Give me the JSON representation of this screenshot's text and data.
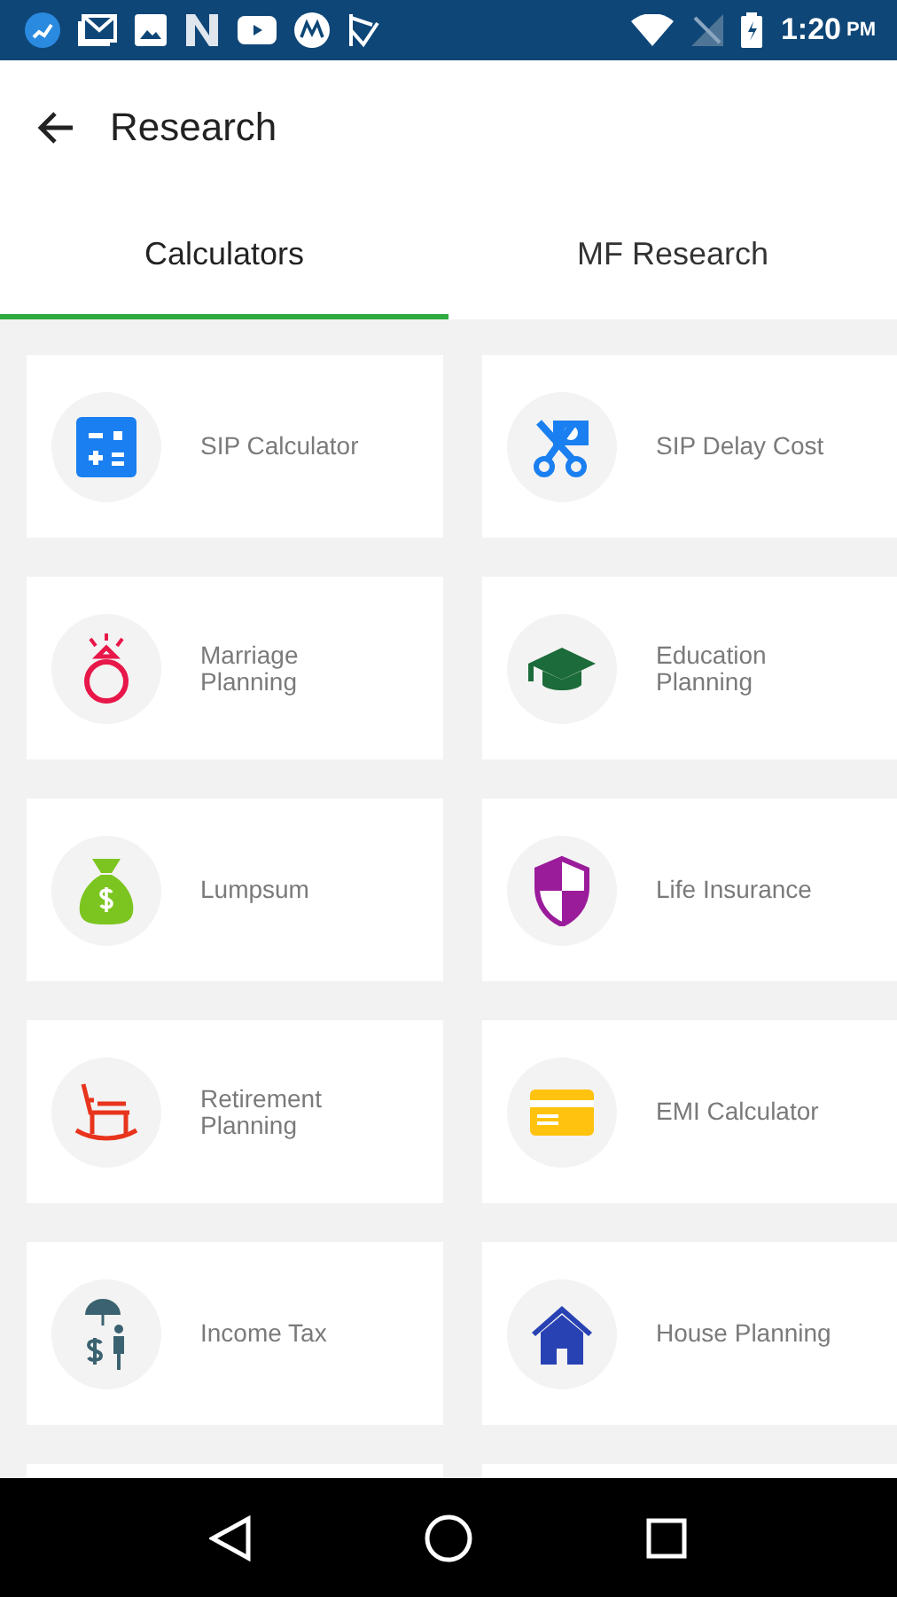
{
  "status_bar": {
    "time": "1:20",
    "period": "PM"
  },
  "app_bar": {
    "title": "Research"
  },
  "tabs": [
    {
      "label": "Calculators",
      "selected": true
    },
    {
      "label": "MF Research",
      "selected": false
    }
  ],
  "tools": [
    {
      "label": "SIP Calculator",
      "kind": "calculator"
    },
    {
      "label": "SIP Delay Cost",
      "kind": "scissors"
    },
    {
      "label": "Marriage\nPlanning",
      "kind": "ring"
    },
    {
      "label": "Education\nPlanning",
      "kind": "cap"
    },
    {
      "label": "Lumpsum",
      "kind": "moneybag"
    },
    {
      "label": "Life Insurance",
      "kind": "shield"
    },
    {
      "label": "Retirement\nPlanning",
      "kind": "rocker"
    },
    {
      "label": "EMI Calculator",
      "kind": "card"
    },
    {
      "label": "Income Tax",
      "kind": "umbrella"
    },
    {
      "label": "House Planning",
      "kind": "house"
    }
  ]
}
